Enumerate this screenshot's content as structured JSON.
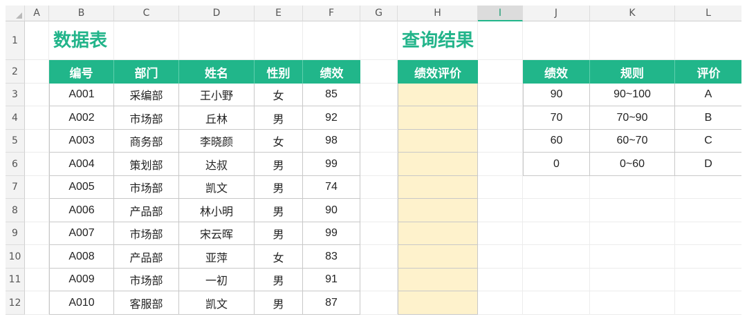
{
  "columns": [
    "A",
    "B",
    "C",
    "D",
    "E",
    "F",
    "G",
    "H",
    "I",
    "J",
    "K",
    "L"
  ],
  "active_column": "I",
  "rows": [
    "1",
    "2",
    "3",
    "4",
    "5",
    "6",
    "7",
    "8",
    "9",
    "10",
    "11",
    "12"
  ],
  "theme": {
    "header_green": "#21b68a",
    "title_green": "#22b48a",
    "result_fill": "#fef2cc"
  },
  "data_table": {
    "title": "数据表",
    "headers": [
      "编号",
      "部门",
      "姓名",
      "性别",
      "绩效"
    ],
    "rows": [
      [
        "A001",
        "采编部",
        "王小野",
        "女",
        "85"
      ],
      [
        "A002",
        "市场部",
        "丘林",
        "男",
        "92"
      ],
      [
        "A003",
        "商务部",
        "李晓颜",
        "女",
        "98"
      ],
      [
        "A004",
        "策划部",
        "达叔",
        "男",
        "99"
      ],
      [
        "A005",
        "市场部",
        "凯文",
        "男",
        "74"
      ],
      [
        "A006",
        "产品部",
        "林小明",
        "男",
        "90"
      ],
      [
        "A007",
        "市场部",
        "宋云晖",
        "男",
        "99"
      ],
      [
        "A008",
        "产品部",
        "亚萍",
        "女",
        "83"
      ],
      [
        "A009",
        "市场部",
        "一初",
        "男",
        "91"
      ],
      [
        "A010",
        "客服部",
        "凯文",
        "男",
        "87"
      ]
    ]
  },
  "query_result": {
    "title": "查询结果",
    "header": "绩效评价"
  },
  "rule_table": {
    "headers": [
      "绩效",
      "规则",
      "评价"
    ],
    "rows": [
      [
        "90",
        "90~100",
        "A"
      ],
      [
        "70",
        "70~90",
        "B"
      ],
      [
        "60",
        "60~70",
        "C"
      ],
      [
        "0",
        "0~60",
        "D"
      ]
    ]
  }
}
